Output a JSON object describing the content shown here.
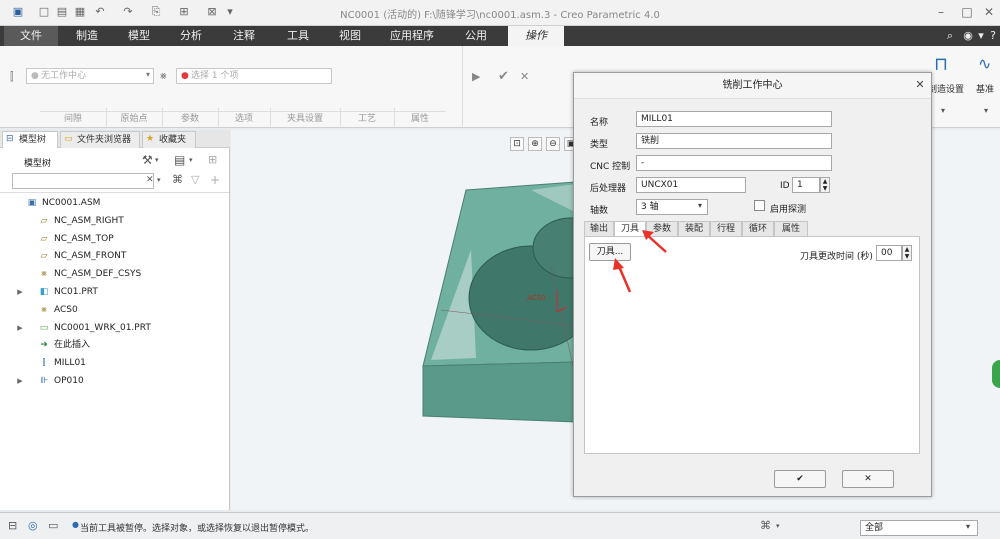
{
  "window": {
    "title": "NC0001 (活动的) F:\\随锋学习\\nc0001.asm.3 - Creo Parametric 4.0"
  },
  "ribbon": {
    "tabs": [
      "文件",
      "制造",
      "模型",
      "分析",
      "注释",
      "工具",
      "视图",
      "应用程序",
      "公用",
      "操作"
    ],
    "active_tab": "操作",
    "workcenter_placeholder": "无工作中心",
    "select_placeholder": "选择 1 个项",
    "group_labels": [
      "间隙",
      "原始点",
      "参数",
      "选项",
      "夹具设置",
      "工艺",
      "属性"
    ],
    "right_button_label": "制造设置",
    "right_button2_label": "基准"
  },
  "left_panel": {
    "tabs": [
      "模型树",
      "文件夹浏览器",
      "收藏夹"
    ],
    "header": "模型树",
    "tree": [
      {
        "label": "NC0001.ASM",
        "icon": "assembly-icon",
        "indent": 0,
        "expandable": false
      },
      {
        "label": "NC_ASM_RIGHT",
        "icon": "datum-plane-icon",
        "indent": 1,
        "expandable": false
      },
      {
        "label": "NC_ASM_TOP",
        "icon": "datum-plane-icon",
        "indent": 1,
        "expandable": false
      },
      {
        "label": "NC_ASM_FRONT",
        "icon": "datum-plane-icon",
        "indent": 1,
        "expandable": false
      },
      {
        "label": "NC_ASM_DEF_CSYS",
        "icon": "csys-icon",
        "indent": 1,
        "expandable": false
      },
      {
        "label": "NC01.PRT",
        "icon": "part-icon",
        "indent": 1,
        "expandable": true
      },
      {
        "label": "ACS0",
        "icon": "csys-icon",
        "indent": 1,
        "expandable": false
      },
      {
        "label": "NC0001_WRK_01.PRT",
        "icon": "workpiece-icon",
        "indent": 1,
        "expandable": true
      },
      {
        "label": "在此插入",
        "icon": "insert-arrow-icon",
        "indent": 1,
        "expandable": false
      },
      {
        "label": "MILL01",
        "icon": "mill-workcenter-icon",
        "indent": 1,
        "expandable": false
      },
      {
        "label": "OP010",
        "icon": "operation-icon",
        "indent": 1,
        "expandable": true
      }
    ]
  },
  "dialog": {
    "title": "铣削工作中心",
    "fields": {
      "name_label": "名称",
      "name_value": "MILL01",
      "type_label": "类型",
      "type_value": "铣削",
      "cnc_label": "CNC 控制",
      "cnc_value": "-",
      "post_label": "后处理器",
      "post_value": "UNCX01",
      "id_label": "ID",
      "id_value": "1",
      "axes_label": "轴数",
      "axes_value": "3 轴",
      "probe_label": "启用探测"
    },
    "tabs": [
      "输出",
      "刀具",
      "参数",
      "装配",
      "行程",
      "循环",
      "属性"
    ],
    "active_tab": "刀具",
    "tools_button": "刀具...",
    "tool_change_label": "刀具更改时间 (秒)",
    "tool_change_value": "00"
  },
  "statusbar": {
    "message": "当前工具被暂停。选择对象，或选择恢复以退出暂停模式。",
    "filter_value": "全部"
  },
  "colors": {
    "model_fill": "#5f9e8f",
    "model_top": "#6fb0a0",
    "arrow": "#e8322a",
    "ribbon_dark": "#3b3b3b"
  }
}
